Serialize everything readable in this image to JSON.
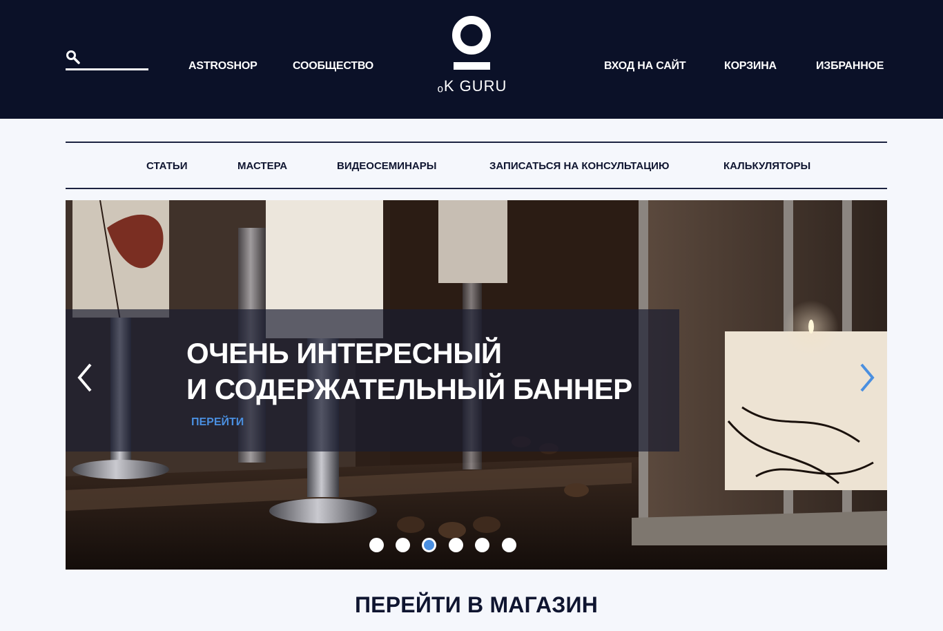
{
  "header": {
    "logo_text": "ₒK GURU",
    "nav_left": [
      "ASTROSHOP",
      "СООБЩЕСТВО"
    ],
    "nav_right": [
      "ВХОД НА САЙТ",
      "КОРЗИНА",
      "ИЗБРАННОЕ"
    ],
    "search_icon": "search-icon",
    "colors": {
      "background": "#0b1128",
      "text": "#ffffff"
    }
  },
  "subnav": {
    "items": [
      "СТАТЬИ",
      "МАСТЕРА",
      "ВИДЕОСЕМИНАРЫ",
      "ЗАПИСАТЬСЯ НА КОНСУЛЬТАЦИЮ",
      "КАЛЬКУЛЯТОРЫ"
    ]
  },
  "banner": {
    "title_line1": "ОЧЕНЬ ИНТЕРЕСНЫЙ",
    "title_line2": "И СОДЕРЖАТЕЛЬНЫЙ БАННЕР",
    "link_label": "ПЕРЕЙТИ",
    "prev_icon": "chevron-left-icon",
    "next_icon": "chevron-right-icon",
    "slide_count": 6,
    "active_slide": 3,
    "accent_color": "#4a8fe0"
  },
  "shop": {
    "heading": "ПЕРЕЙТИ В МАГАЗИН"
  }
}
